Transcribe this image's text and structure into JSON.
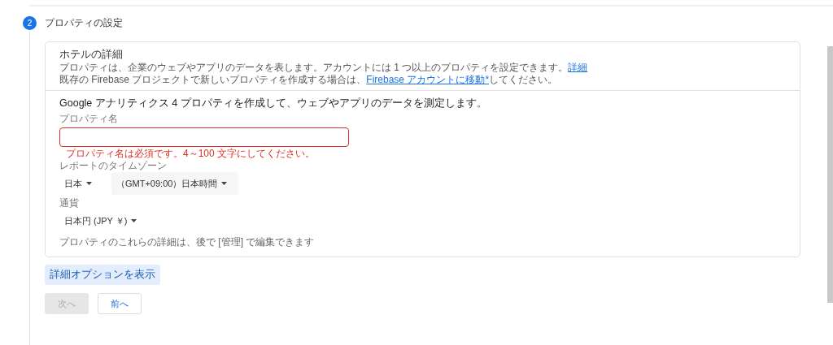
{
  "step": {
    "number": "2",
    "title": "プロパティの設定"
  },
  "card": {
    "title": "ホテルの詳細",
    "description": [
      {
        "text": "プロパティは、企業のウェブやアプリのデータを表します。アカウントには 1 つ以上のプロパティを設定できます。",
        "link": "詳細"
      },
      {
        "text": "既存の Firebase プロジェクトで新しいプロパティを作成する場合は、",
        "link": "Firebase アカウントに移動*",
        "after": "してください。"
      }
    ],
    "intro": "Google アナリティクス 4 プロパティを作成して、ウェブやアプリのデータを測定します。",
    "property_name": {
      "label": "プロパティ名",
      "invalid": true,
      "error": "プロパティ名は必須です。4～100 文字にしてください。"
    },
    "timezone": {
      "label": "レポートのタイムゾーン",
      "country": "日本",
      "zone": "（GMT+09:00）日本時間"
    },
    "currency": {
      "label": "通貨",
      "value": "日本円 (JPY ￥)"
    },
    "note": "プロパティのこれらの詳細は、後で [管理] で編集できます"
  },
  "advanced_button": "詳細オプションを表示",
  "buttons": [
    {
      "label": "次へ",
      "disabled": true
    },
    {
      "label": "前へ",
      "disabled": false
    }
  ]
}
